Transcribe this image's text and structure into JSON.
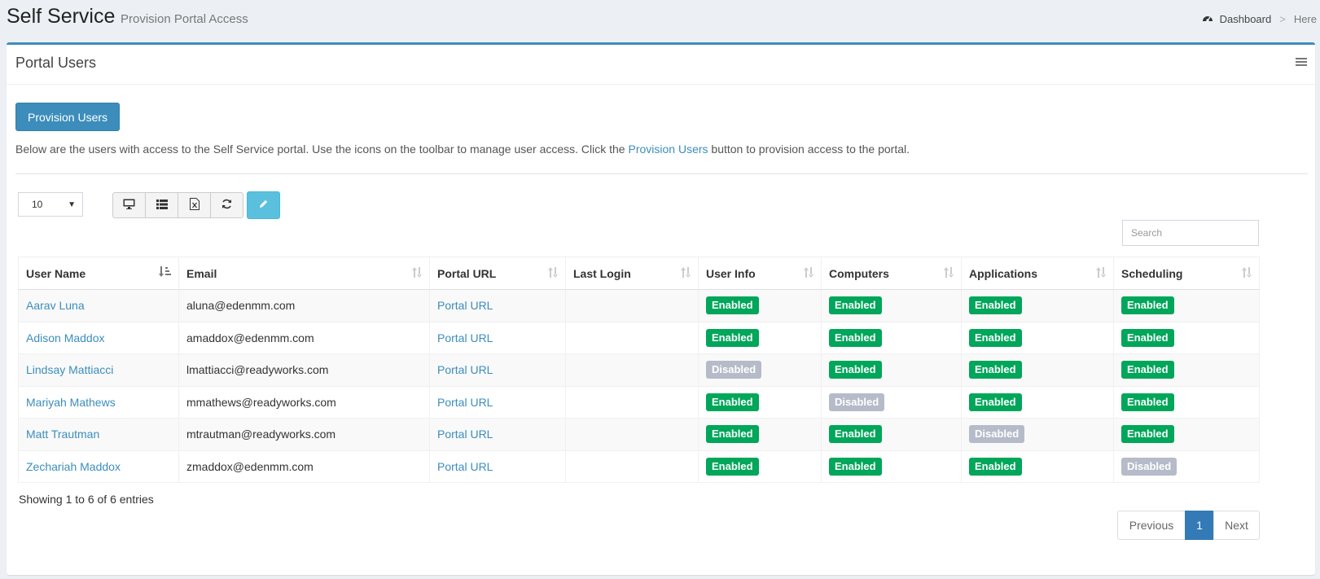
{
  "header": {
    "title": "Self Service",
    "subtitle": "Provision Portal Access",
    "breadcrumb": {
      "dashboard": "Dashboard",
      "separator": ">",
      "here": "Here"
    }
  },
  "box": {
    "title": "Portal Users",
    "provision_button": "Provision Users",
    "intro_before": "Below are the users with access to the Self Service portal. Use the icons on the toolbar to manage user access. Click the ",
    "intro_link": "Provision Users",
    "intro_after": " button to provision access to the portal."
  },
  "controls": {
    "page_size": "10",
    "search_placeholder": "Search",
    "toolbar_icons": [
      "desktop-icon",
      "list-icon",
      "excel-icon",
      "refresh-icon",
      "pencil-icon"
    ]
  },
  "table": {
    "columns": [
      "User Name",
      "Email",
      "Portal URL",
      "Last Login",
      "User Info",
      "Computers",
      "Applications",
      "Scheduling"
    ],
    "rows": [
      {
        "name": "Aarav Luna",
        "email": "aluna@edenmm.com",
        "url": "Portal URL",
        "last_login": "",
        "user_info": "Enabled",
        "computers": "Enabled",
        "applications": "Enabled",
        "scheduling": "Enabled"
      },
      {
        "name": "Adison Maddox",
        "email": "amaddox@edenmm.com",
        "url": "Portal URL",
        "last_login": "",
        "user_info": "Enabled",
        "computers": "Enabled",
        "applications": "Enabled",
        "scheduling": "Enabled"
      },
      {
        "name": "Lindsay Mattiacci",
        "email": "lmattiacci@readyworks.com",
        "url": "Portal URL",
        "last_login": "",
        "user_info": "Disabled",
        "computers": "Enabled",
        "applications": "Enabled",
        "scheduling": "Enabled"
      },
      {
        "name": "Mariyah Mathews",
        "email": "mmathews@readyworks.com",
        "url": "Portal URL",
        "last_login": "",
        "user_info": "Enabled",
        "computers": "Disabled",
        "applications": "Enabled",
        "scheduling": "Enabled"
      },
      {
        "name": "Matt Trautman",
        "email": "mtrautman@readyworks.com",
        "url": "Portal URL",
        "last_login": "",
        "user_info": "Enabled",
        "computers": "Enabled",
        "applications": "Disabled",
        "scheduling": "Enabled"
      },
      {
        "name": "Zechariah Maddox",
        "email": "zmaddox@edenmm.com",
        "url": "Portal URL",
        "last_login": "",
        "user_info": "Enabled",
        "computers": "Enabled",
        "applications": "Enabled",
        "scheduling": "Disabled"
      }
    ]
  },
  "footer": {
    "info": "Showing 1 to 6 of 6 entries",
    "previous": "Previous",
    "current_page": "1",
    "next": "Next"
  },
  "colors": {
    "primary": "#3c8dbc",
    "enabled": "#00a65a",
    "disabled": "#b5bbc8",
    "edit_button": "#5bc0de",
    "page_active": "#337ab7"
  }
}
